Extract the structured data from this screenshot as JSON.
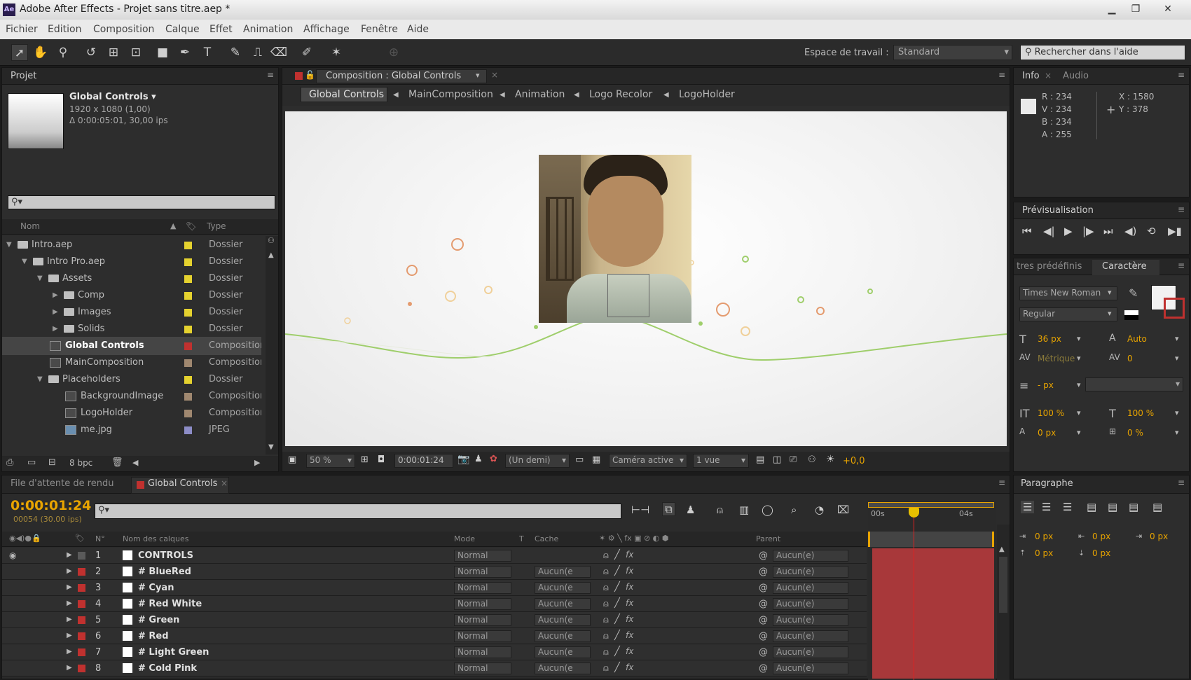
{
  "titlebar": {
    "title": "Adobe After Effects - Projet sans titre.aep *",
    "app_icon": "Ae"
  },
  "menu": [
    "Fichier",
    "Edition",
    "Composition",
    "Calque",
    "Effet",
    "Animation",
    "Affichage",
    "Fenêtre",
    "Aide"
  ],
  "toolbar": {
    "workspace_label": "Espace de travail :",
    "workspace_value": "Standard",
    "help_placeholder": "Rechercher dans l'aide"
  },
  "project": {
    "tab": "Projet",
    "selected_name": "Global Controls ▾",
    "selected_res": "1920 x 1080 (1,00)",
    "selected_dur": "Δ 0:00:05:01, 30,00 ips",
    "col_name": "Nom",
    "col_type": "Type",
    "items": [
      {
        "name": "Intro.aep",
        "type": "Dossier"
      },
      {
        "name": "Intro Pro.aep",
        "type": "Dossier"
      },
      {
        "name": "Assets",
        "type": "Dossier"
      },
      {
        "name": "Comp",
        "type": "Dossier"
      },
      {
        "name": "Images",
        "type": "Dossier"
      },
      {
        "name": "Solids",
        "type": "Dossier"
      },
      {
        "name": "Global Controls",
        "type": "Composition"
      },
      {
        "name": "MainComposition",
        "type": "Composition"
      },
      {
        "name": "Placeholders",
        "type": "Dossier"
      },
      {
        "name": "BackgroundImage",
        "type": "Composition"
      },
      {
        "name": "LogoHolder",
        "type": "Composition"
      },
      {
        "name": "me.jpg",
        "type": "JPEG"
      }
    ],
    "bpc": "8 bpc"
  },
  "composition": {
    "tab": "Composition : Global Controls",
    "breadcrumbs": [
      "Global Controls",
      "MainComposition",
      "Animation",
      "Logo Recolor",
      "LogoHolder"
    ],
    "zoom": "50 %",
    "time": "0:00:01:24",
    "resolution": "(Un demi)",
    "camera": "Caméra active",
    "views": "1 vue",
    "exposure": "+0,0"
  },
  "info": {
    "tab_info": "Info",
    "tab_audio": "Audio",
    "r": "R : 234",
    "v": "V : 234",
    "b": "B : 234",
    "a": "A : 255",
    "x": "X : 1580",
    "y": "Y : 378"
  },
  "preview": {
    "tab": "Prévisualisation"
  },
  "character": {
    "tab_presets": "tres prédéfinis",
    "tab_char": "Caractère",
    "font": "Times New Roman",
    "style": "Regular",
    "size": "36 px",
    "leading": "Auto",
    "kerning": "Métrique",
    "tracking": "0",
    "stroke": "- px",
    "vscale": "100 %",
    "hscale": "100 %",
    "baseline": "0 px",
    "tsume": "0 %"
  },
  "paragraph": {
    "tab": "Paragraphe",
    "v1": "0 px",
    "v2": "0 px",
    "v3": "0 px",
    "v4": "0 px",
    "v5": "0 px"
  },
  "timeline": {
    "tab_render": "File d'attente de rendu",
    "tab_comp": "Global Controls",
    "timecode": "0:00:01:24",
    "frames": "00054 (30.00 ips)",
    "col_n": "N°",
    "col_name": "Nom des calques",
    "col_mode": "Mode",
    "col_t": "T",
    "col_mask": "Cache",
    "col_parent": "Parent",
    "ruler": [
      "00s",
      "04s"
    ],
    "layers": [
      {
        "n": "1",
        "name": "CONTROLS",
        "mode": "Normal",
        "mask": "",
        "parent": "Aucun(e)"
      },
      {
        "n": "2",
        "name": "# BlueRed",
        "mode": "Normal",
        "mask": "Aucun(e",
        "parent": "Aucun(e)"
      },
      {
        "n": "3",
        "name": "# Cyan",
        "mode": "Normal",
        "mask": "Aucun(e",
        "parent": "Aucun(e)"
      },
      {
        "n": "4",
        "name": "# Red White",
        "mode": "Normal",
        "mask": "Aucun(e",
        "parent": "Aucun(e)"
      },
      {
        "n": "5",
        "name": "# Green",
        "mode": "Normal",
        "mask": "Aucun(e",
        "parent": "Aucun(e)"
      },
      {
        "n": "6",
        "name": "# Red",
        "mode": "Normal",
        "mask": "Aucun(e",
        "parent": "Aucun(e)"
      },
      {
        "n": "7",
        "name": "# Light Green",
        "mode": "Normal",
        "mask": "Aucun(e",
        "parent": "Aucun(e)"
      },
      {
        "n": "8",
        "name": "# Cold Pink",
        "mode": "Normal",
        "mask": "Aucun(e",
        "parent": "Aucun(e)"
      }
    ]
  },
  "colors": {
    "accent_orange": "#e8a400",
    "label_red": "#c0312f",
    "folder_yellow": "#e5d22f"
  }
}
